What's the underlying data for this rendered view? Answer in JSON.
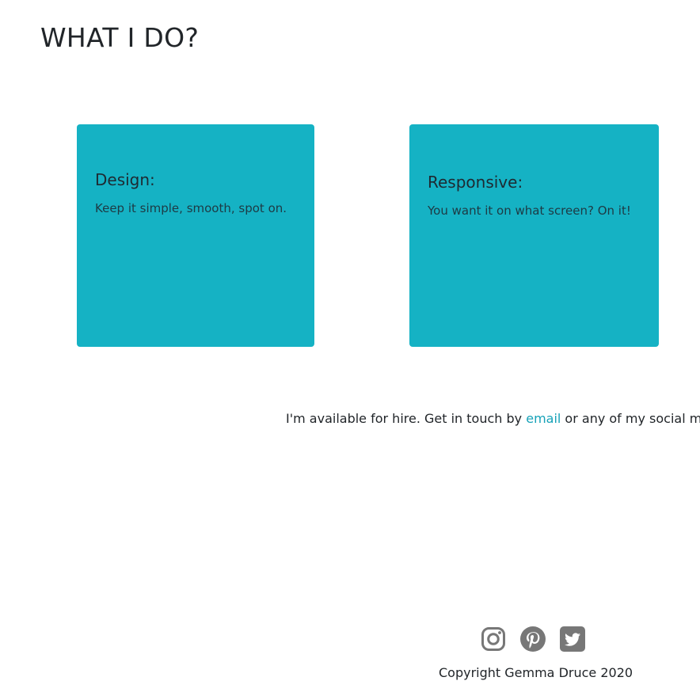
{
  "section": {
    "title": "WHAT I DO?"
  },
  "cards": [
    {
      "title": "Design:",
      "text": "Keep it simple, smooth, spot on."
    },
    {
      "title": "Responsive:",
      "text": "You want it on what screen? On it!"
    }
  ],
  "contact": {
    "before": "I'm available for hire. Get in touch by ",
    "link": "email",
    "after": " or any of my social me"
  },
  "footer": {
    "social_icons": [
      "instagram-icon",
      "pinterest-icon",
      "twitter-icon"
    ],
    "copyright": "Copyright Gemma Druce 2020"
  },
  "colors": {
    "card_background": "#15b2c4",
    "link": "#17a2b8",
    "icon": "#777777"
  }
}
